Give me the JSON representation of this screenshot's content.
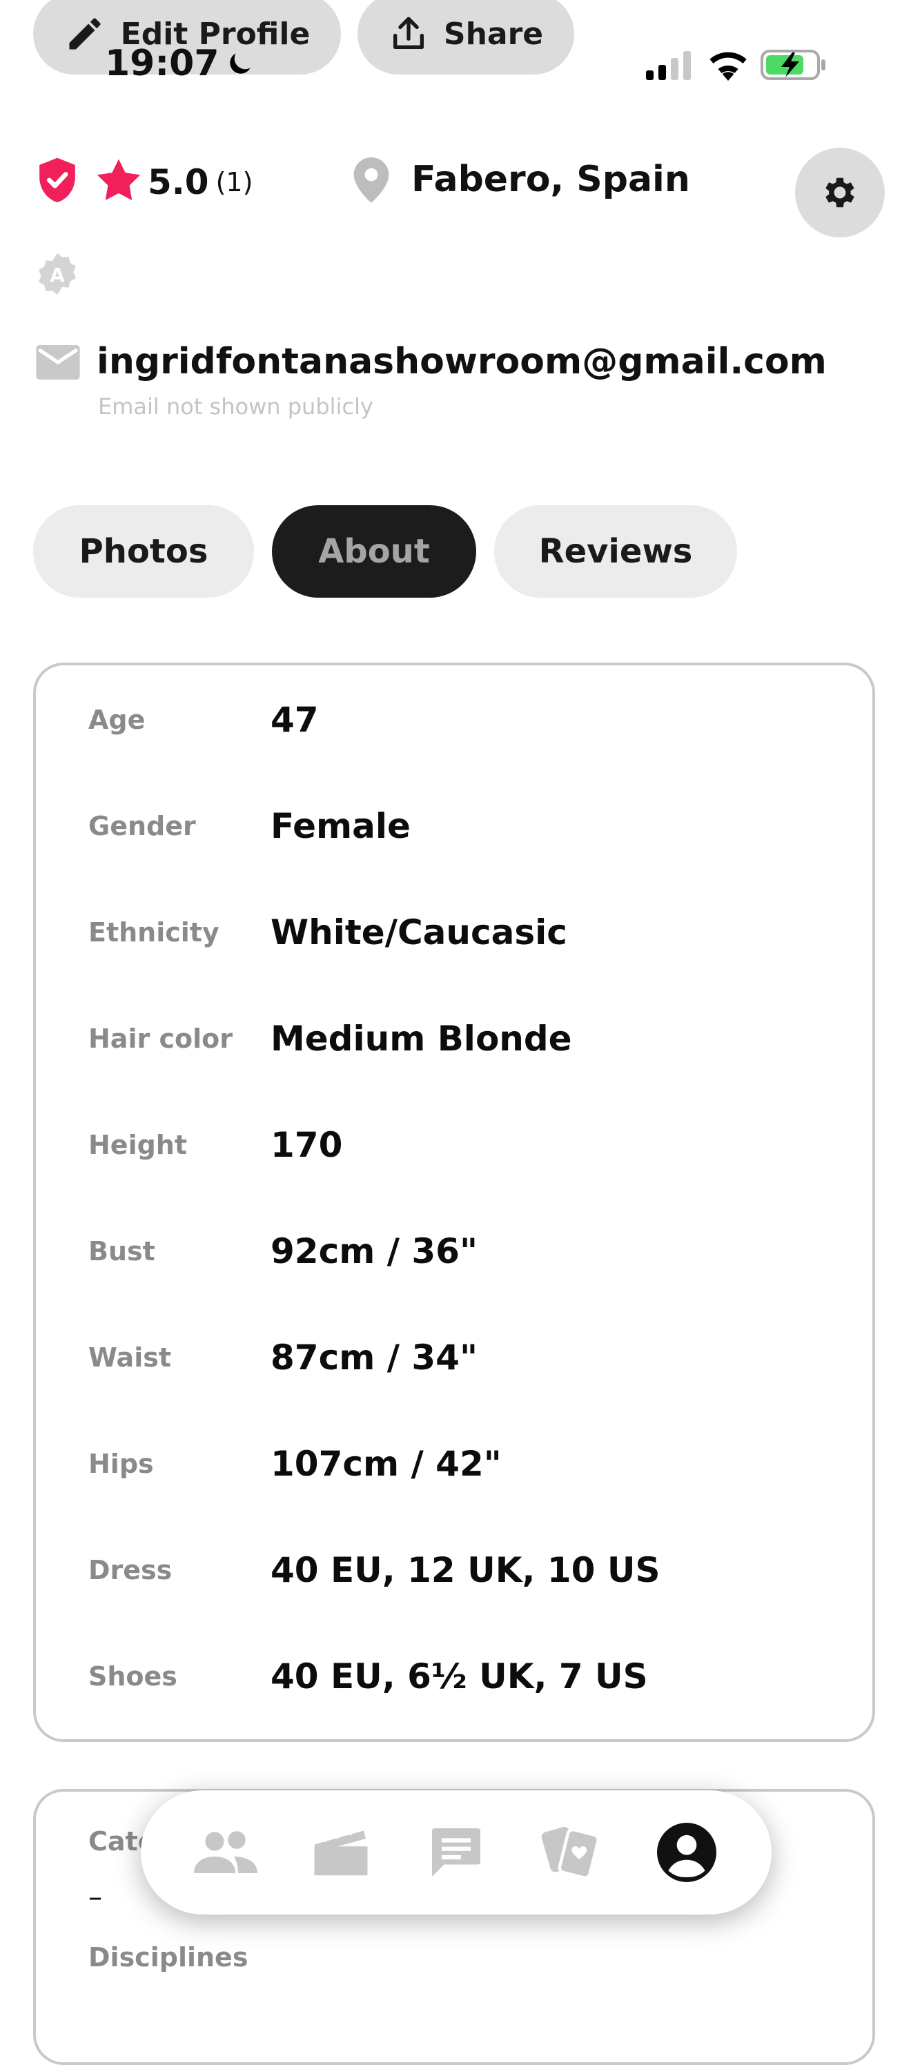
{
  "top_actions": {
    "edit_label": "Edit Profile",
    "share_label": "Share"
  },
  "status_bar": {
    "time": "19:07"
  },
  "profile": {
    "rating": "5.0",
    "rating_count": "(1)",
    "location": "Fabero, Spain",
    "email": "ingridfontanashowroom@gmail.com",
    "email_note": "Email not shown publicly",
    "badge_letter": "A"
  },
  "tabs": [
    {
      "label": "Photos",
      "active": false
    },
    {
      "label": "About",
      "active": true
    },
    {
      "label": "Reviews",
      "active": false
    }
  ],
  "about": [
    {
      "label": "Age",
      "value": "47"
    },
    {
      "label": "Gender",
      "value": "Female"
    },
    {
      "label": "Ethnicity",
      "value": "White/Caucasic"
    },
    {
      "label": "Hair color",
      "value": "Medium Blonde"
    },
    {
      "label": "Height",
      "value": "170"
    },
    {
      "label": "Bust",
      "value": "92cm / 36\""
    },
    {
      "label": "Waist",
      "value": "87cm / 34\""
    },
    {
      "label": "Hips",
      "value": "107cm / 42\""
    },
    {
      "label": "Dress",
      "value": "40 EU, 12 UK, 10 US"
    },
    {
      "label": "Shoes",
      "value": "40 EU, 6½ UK, 7 US"
    }
  ],
  "second_card": {
    "category_label": "Cate",
    "category_value": "–",
    "disciplines_label": "Disciplines"
  },
  "colors": {
    "accent_pink": "#f0205a",
    "active_tab_bg": "#1c1c1c",
    "active_tab_text": "#a5a5a5",
    "battery_green": "#4cd964"
  },
  "nav": [
    {
      "icon": "people-icon",
      "active": false
    },
    {
      "icon": "clapperboard-icon",
      "active": false
    },
    {
      "icon": "chat-icon",
      "active": false
    },
    {
      "icon": "cards-icon",
      "active": false
    },
    {
      "icon": "profile-icon",
      "active": true
    }
  ]
}
